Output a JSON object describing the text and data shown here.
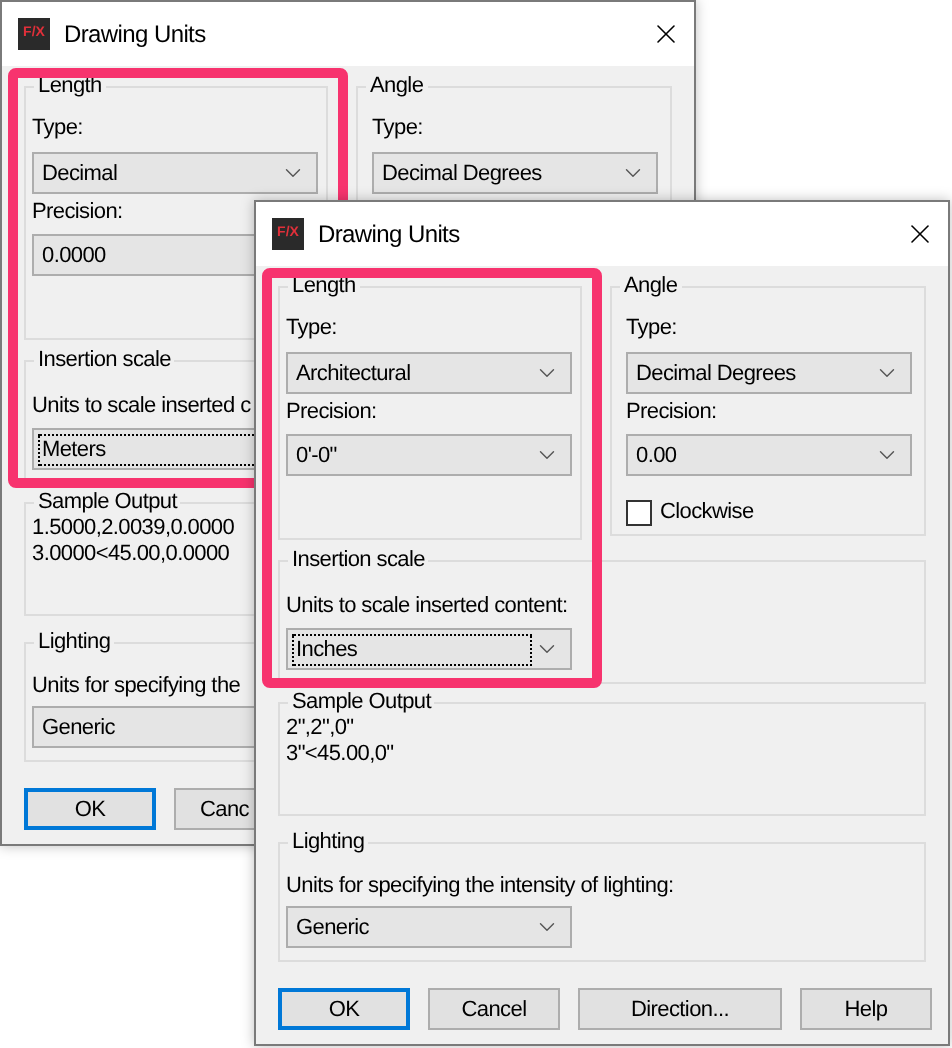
{
  "windows": [
    {
      "title": "Drawing Units",
      "icon_text": "F/X",
      "highlighted": true,
      "length": {
        "legend": "Length",
        "type_label": "Type:",
        "type": {
          "value": "Decimal",
          "kind": "full",
          "focused": false
        },
        "precision_label": "Precision:",
        "precision": {
          "value": "0.0000",
          "kind": "cut",
          "focused": false
        }
      },
      "angle": {
        "legend": "Angle",
        "type_label": "Type:",
        "type": {
          "value": "Decimal Degrees",
          "kind": "full",
          "focused": false
        }
      },
      "insertion": {
        "legend": "Insertion scale",
        "label": "Units to scale inserted c",
        "units": {
          "value": "Meters",
          "kind": "cut",
          "focused": true
        }
      },
      "sample": {
        "legend": "Sample Output",
        "lines": [
          "1.5000,2.0039,0.0000",
          "3.0000<45.00,0.0000"
        ]
      },
      "lighting": {
        "legend": "Lighting",
        "label": "Units for specifying the",
        "units": {
          "value": "Generic",
          "kind": "cut",
          "focused": false
        }
      },
      "buttons": [
        {
          "label": "OK",
          "default": true,
          "kind": "full"
        },
        {
          "label": "Canc",
          "default": false,
          "kind": "cut"
        }
      ]
    },
    {
      "title": "Drawing Units",
      "icon_text": "F/X",
      "highlighted": true,
      "length": {
        "legend": "Length",
        "type_label": "Type:",
        "type": {
          "value": "Architectural",
          "kind": "full",
          "focused": false
        },
        "precision_label": "Precision:",
        "precision": {
          "value": "0'-0\"",
          "kind": "full",
          "focused": false
        }
      },
      "angle": {
        "legend": "Angle",
        "type_label": "Type:",
        "type": {
          "value": "Decimal Degrees",
          "kind": "full",
          "focused": false
        },
        "precision_label": "Precision:",
        "precision": {
          "value": "0.00",
          "kind": "full",
          "focused": false
        },
        "clockwise": {
          "label": "Clockwise",
          "checked": false
        }
      },
      "insertion": {
        "legend": "Insertion scale",
        "label": "Units to scale inserted content:",
        "units": {
          "value": "Inches",
          "kind": "full",
          "focused": true
        }
      },
      "sample": {
        "legend": "Sample Output",
        "lines": [
          "2\",2\",0\"",
          "3\"<45.00,0\""
        ]
      },
      "lighting": {
        "legend": "Lighting",
        "label": "Units for specifying the intensity of lighting:",
        "units": {
          "value": "Generic",
          "kind": "full",
          "focused": false
        }
      },
      "buttons": [
        {
          "label": "OK",
          "default": true,
          "kind": "full"
        },
        {
          "label": "Cancel",
          "default": false,
          "kind": "full"
        },
        {
          "label": "Direction...",
          "default": false,
          "kind": "full"
        },
        {
          "label": "Help",
          "default": false,
          "kind": "full"
        }
      ]
    }
  ]
}
